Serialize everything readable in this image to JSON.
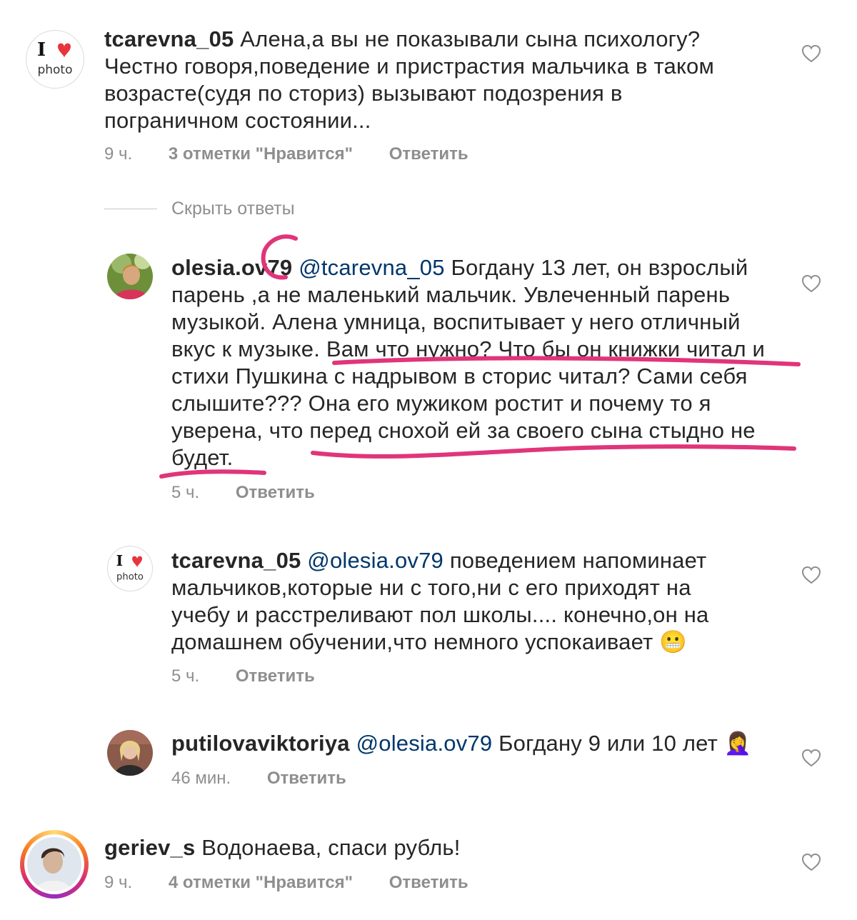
{
  "comments": [
    {
      "username": "tcarevna_05",
      "text": "Алена,а вы не показывали сына психологу? Честно говоря,поведение и пристрастия мальчика в таком возрасте(судя по сториз) вызывают подозрения в пограничном состоянии...",
      "time": "9 ч.",
      "likes": "3 отметки \"Нравится\"",
      "reply": "Ответить",
      "avatar_text_top": "I",
      "avatar_text_bottom": "photo"
    },
    {
      "username": "geriev_s",
      "text": "Водонаева, спаси рубль!",
      "time": "9 ч.",
      "likes": "4 отметки \"Нравится\"",
      "reply": "Ответить"
    }
  ],
  "hide_replies": "Скрыть ответы",
  "replies": [
    {
      "username": "olesia.ov79",
      "mention": "@tcarevna_05",
      "text": "Богдану 13 лет, он взрослый парень ,а не маленький мальчик. Увлеченный парень музыкой. Алена умница, воспитывает у него отличный вкус к музыке. Вам что нужно? Что бы он книжки читал и стихи Пушкина с надрывом в сторис читал? Сами себя слышите??? Она его мужиком ростит и почему то я уверена, что перед снохой ей за своего сына стыдно не будет.",
      "time": "5 ч.",
      "reply": "Ответить"
    },
    {
      "username": "tcarevna_05",
      "mention": "@olesia.ov79",
      "text": "поведением напоминает мальчиков,которые ни с того,ни с его приходят на учебу и расстреливают пол школы.... конечно,он на домашнем обучении,что немного успокаивает 😬",
      "time": "5 ч.",
      "reply": "Ответить",
      "avatar_text_top": "I",
      "avatar_text_bottom": "photo"
    },
    {
      "username": "putilovaviktoriya",
      "mention": "@olesia.ov79",
      "text": "Богдану 9 или 10 лет 🤦‍♀️",
      "time": "46 мин.",
      "reply": "Ответить"
    }
  ],
  "colors": {
    "text": "#262626",
    "meta": "#8e8e8e",
    "mention": "#00376b",
    "annotation": "#e0357a",
    "heart_logo": "#e8343c"
  }
}
